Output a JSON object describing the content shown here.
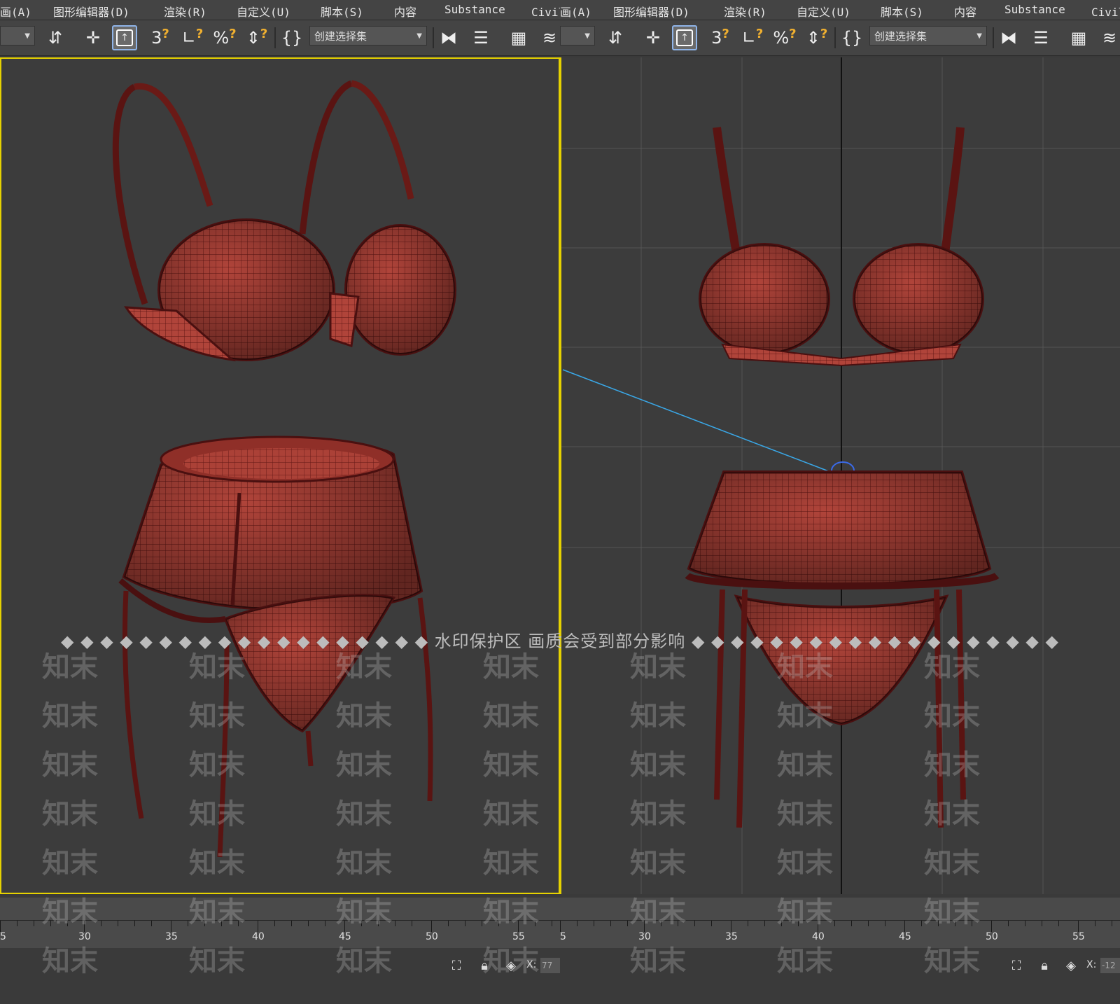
{
  "menu": [
    "画(A)",
    "图形编辑器(D)",
    "渲染(R)",
    "自定义(U)",
    "脚本(S)",
    "内容",
    "Substance",
    "Civil视(A)"
  ],
  "toolbar": {
    "selection_set_placeholder": "创建选择集"
  },
  "timeline": {
    "labels": [
      "5",
      "30",
      "35",
      "40",
      "45",
      "50",
      "55"
    ]
  },
  "status": {
    "x_label": "X:",
    "x_value_left": "77",
    "x_value_right": "-12"
  },
  "watermark": {
    "banner": "水印保护区 画质会受到部分影响",
    "text": "知末"
  },
  "colors": {
    "mesh_fill": "#b0443a",
    "mesh_dark": "#5a1412",
    "viewport_border": "#e6d200",
    "pivot_line": "#3aa8e8"
  }
}
